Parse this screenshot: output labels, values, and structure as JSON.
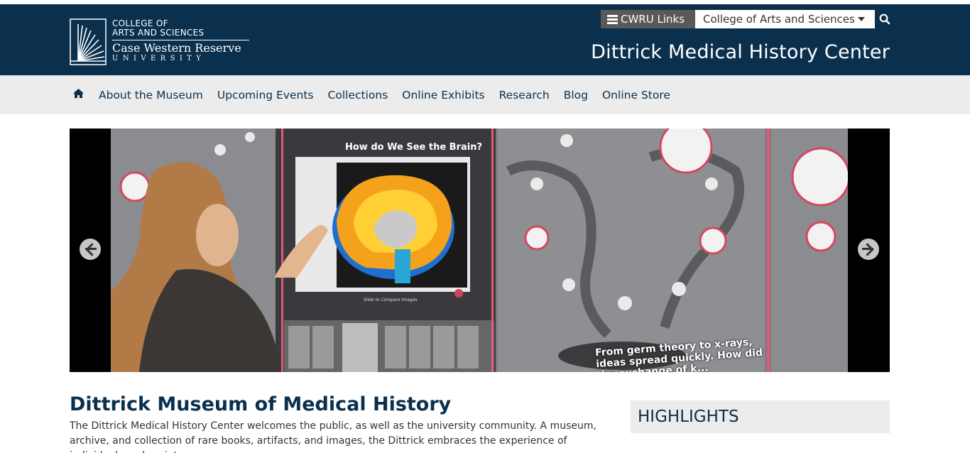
{
  "header": {
    "logo": {
      "line1": "COLLEGE OF",
      "line2": "ARTS AND SCIENCES",
      "line3": "Case Western Reserve",
      "line4": "UNIVERSITY"
    },
    "cwru_links_label": "CWRU Links",
    "college_select_value": "College of Arts and Sciences",
    "site_title": "Dittrick Medical History Center",
    "colors": {
      "header_bg": "#0a304e",
      "nav_bg": "#ececec",
      "accent": "#0a304e"
    }
  },
  "nav": {
    "home_icon": "home-icon",
    "items": [
      {
        "label": "About the Museum"
      },
      {
        "label": "Upcoming Events"
      },
      {
        "label": "Collections"
      },
      {
        "label": "Online Exhibits"
      },
      {
        "label": "Research"
      },
      {
        "label": "Blog"
      },
      {
        "label": "Online Store"
      }
    ]
  },
  "hero": {
    "screen_title": "How do We See the Brain?",
    "screen_subtitle": "Slide to Compare Images",
    "caption_line1": "From germ theory to x-rays,",
    "caption_line2": "ideas spread quickly. How did",
    "caption_line3": "the exchange of k...",
    "prev_icon": "arrow-left-icon",
    "next_icon": "arrow-right-icon"
  },
  "main": {
    "title": "Dittrick Museum of Medical History",
    "intro": "The Dittrick Medical History Center welcomes the public, as well as the university community. A museum, archive, and collection of rare books, artifacts, and images, the Dittrick embraces the experience of individuals and society"
  },
  "sidebar": {
    "highlights_title": "HIGHLIGHTS"
  }
}
